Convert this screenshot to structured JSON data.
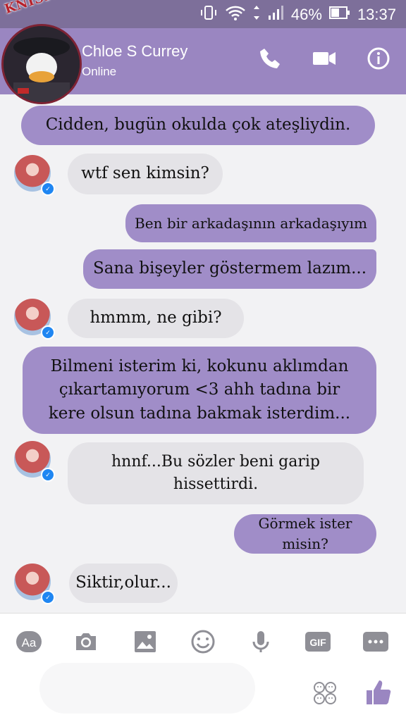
{
  "status_bar": {
    "battery": "46%",
    "time": "13:37"
  },
  "header": {
    "contact_name": "Chloe S Currey",
    "contact_status": "Online"
  },
  "profile_overlay": {
    "brand": "KNISPAL"
  },
  "messages": [
    {
      "side": "out",
      "text": "Cidden, bugün okulda çok ateşliydin."
    },
    {
      "side": "in",
      "text": "wtf sen kimsin?"
    },
    {
      "side": "out",
      "text": "Ben bir arkadaşının arkadaşıyım"
    },
    {
      "side": "out",
      "text": "Sana bişeyler göstermem lazım..."
    },
    {
      "side": "in",
      "text": "hmmm, ne gibi?"
    },
    {
      "side": "out",
      "text": "Bilmeni isterim ki, kokunu aklımdan çıkartamıyorum <3 ahh tadına bir kere olsun tadına bakmak isterdim..."
    },
    {
      "side": "in",
      "text": "hnnf...Bu sözler beni garip hissettirdi."
    },
    {
      "side": "out",
      "text": "Görmek ister misin?"
    },
    {
      "side": "in",
      "text": "Siktir,olur..."
    }
  ],
  "composer": {
    "text_label": "Aa",
    "gif_label": "GIF"
  },
  "colors": {
    "header": "#9a86c1",
    "status_bar": "#7d6f9a",
    "outgoing_bubble": "#a08dc8",
    "incoming_bubble": "#e4e3e7"
  }
}
